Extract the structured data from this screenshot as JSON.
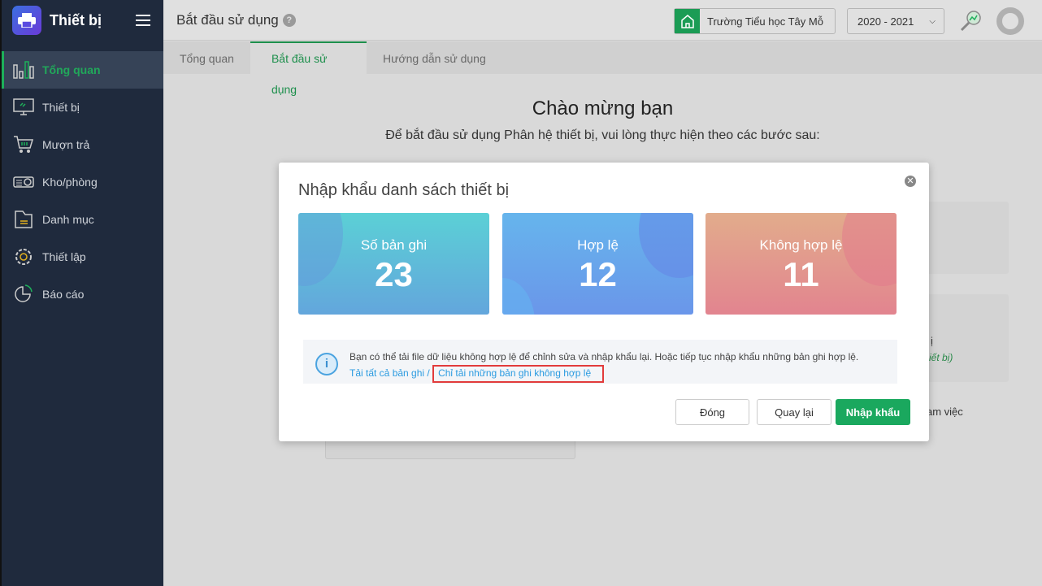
{
  "sidebar": {
    "title": "Thiết bị",
    "items": [
      {
        "label": "Tổng quan",
        "icon": "bar-chart-icon"
      },
      {
        "label": "Thiết bị",
        "icon": "monitor-icon"
      },
      {
        "label": "Mượn trả",
        "icon": "cart-icon"
      },
      {
        "label": "Kho/phòng",
        "icon": "projector-icon"
      },
      {
        "label": "Danh mục",
        "icon": "folder-icon"
      },
      {
        "label": "Thiết lập",
        "icon": "gear-icon"
      },
      {
        "label": "Báo cáo",
        "icon": "pie-chart-icon"
      }
    ]
  },
  "header": {
    "title": "Bắt đầu sử dụng",
    "help": "?",
    "school": "Trường Tiểu học Tây Mỗ",
    "year": "2020 - 2021"
  },
  "tabs": [
    "Tổng quan",
    "Bắt đầu sử dụng",
    "Hướng dẫn sử dụng"
  ],
  "welcome": {
    "title": "Chào mừng bạn",
    "subtitle": "Để bắt đầu sử dụng Phân hệ thiết bị, vui lòng thực hiện theo các bước sau:"
  },
  "background_fragments": [
    "ị",
    "iết bị)",
    "am việc"
  ],
  "modal": {
    "title": "Nhập khẩu danh sách thiết bị",
    "stats": [
      {
        "label": "Số bản ghi",
        "value": "23"
      },
      {
        "label": "Hợp lệ",
        "value": "12"
      },
      {
        "label": "Không hợp lệ",
        "value": "11"
      }
    ],
    "info": "Bạn có thể tải file dữ liệu không hợp lệ để chỉnh sửa và nhập khẩu lại. Hoặc tiếp tục nhập khẩu những bản ghi hợp lệ.",
    "link_all": "Tải tất cả bản ghi",
    "separator": "/",
    "link_invalid": "Chỉ tải những bản ghi không hợp lệ",
    "buttons": {
      "close": "Đóng",
      "back": "Quay lại",
      "import": "Nhập khẩu"
    }
  },
  "colors": {
    "accent": "#1aa85e",
    "sidebar": "#1f2a3d",
    "link": "#2b9be0"
  }
}
